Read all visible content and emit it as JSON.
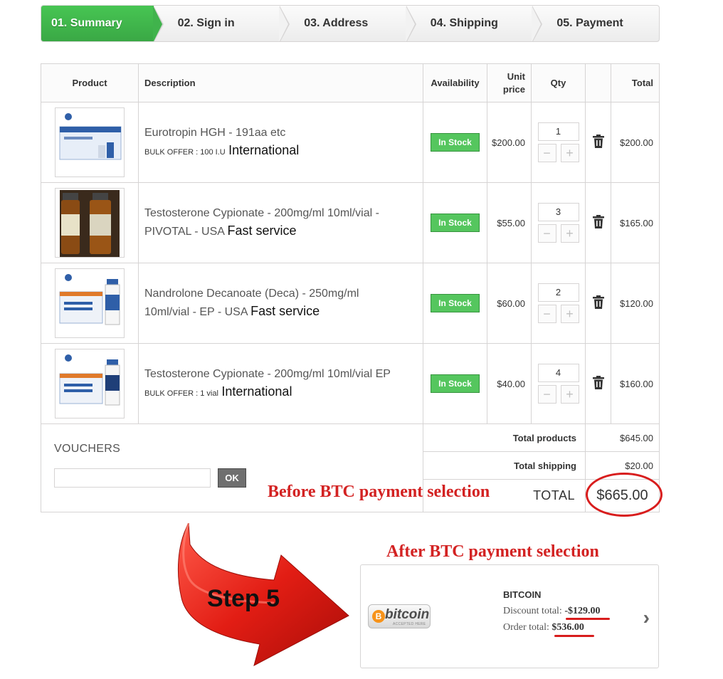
{
  "steps": [
    "01. Summary",
    "02. Sign in",
    "03. Address",
    "04. Shipping",
    "05. Payment"
  ],
  "table": {
    "headers": {
      "product": "Product",
      "description": "Description",
      "availability": "Availability",
      "unit_price_1": "Unit",
      "unit_price_2": "price",
      "qty": "Qty",
      "total": "Total"
    },
    "rows": [
      {
        "name": "Eurotropin HGH - 191aa etc",
        "name_line2": "",
        "extra": "BULK OFFER : 100 I.U",
        "tag": "International",
        "availability": "In Stock",
        "unit_price": "$200.00",
        "qty": "1",
        "total": "$200.00"
      },
      {
        "name": "Testosterone Cypionate - 200mg/ml 10ml/vial -",
        "name_line2": "PIVOTAL - USA",
        "extra": "",
        "tag": "Fast service",
        "availability": "In Stock",
        "unit_price": "$55.00",
        "qty": "3",
        "total": "$165.00"
      },
      {
        "name": "Nandrolone Decanoate (Deca) - 250mg/ml",
        "name_line2": "10ml/vial - EP - USA",
        "extra": "",
        "tag": "Fast service",
        "availability": "In Stock",
        "unit_price": "$60.00",
        "qty": "2",
        "total": "$120.00"
      },
      {
        "name": "Testosterone Cypionate - 200mg/ml 10ml/vial EP",
        "name_line2": "",
        "extra": "BULK OFFER : 1 vial",
        "tag": "International",
        "availability": "In Stock",
        "unit_price": "$40.00",
        "qty": "4",
        "total": "$160.00"
      }
    ],
    "qty_minus": "−",
    "qty_plus": "+",
    "totals": {
      "products_label": "Total products",
      "products_value": "$645.00",
      "shipping_label": "Total shipping",
      "shipping_value": "$20.00",
      "total_label": "TOTAL",
      "total_value": "$665.00"
    }
  },
  "vouchers": {
    "title": "VOUCHERS",
    "input_value": "",
    "ok_label": "OK"
  },
  "annotations": {
    "before": "Before BTC payment selection",
    "after": "After BTC payment selection",
    "step": "Step 5"
  },
  "payment": {
    "logo_text": "bitcoin",
    "logo_sub": "ACCEPTED HERE",
    "logo_coin": "B",
    "title": "BITCOIN",
    "discount_label": "Discount total:",
    "discount_value": "-$129.00",
    "order_label": "Order total:",
    "order_value": "$536.00",
    "chevron": "›"
  },
  "colors": {
    "active_step": "#40b34c",
    "in_stock": "#55c65e",
    "annotation_red": "#d32222"
  }
}
